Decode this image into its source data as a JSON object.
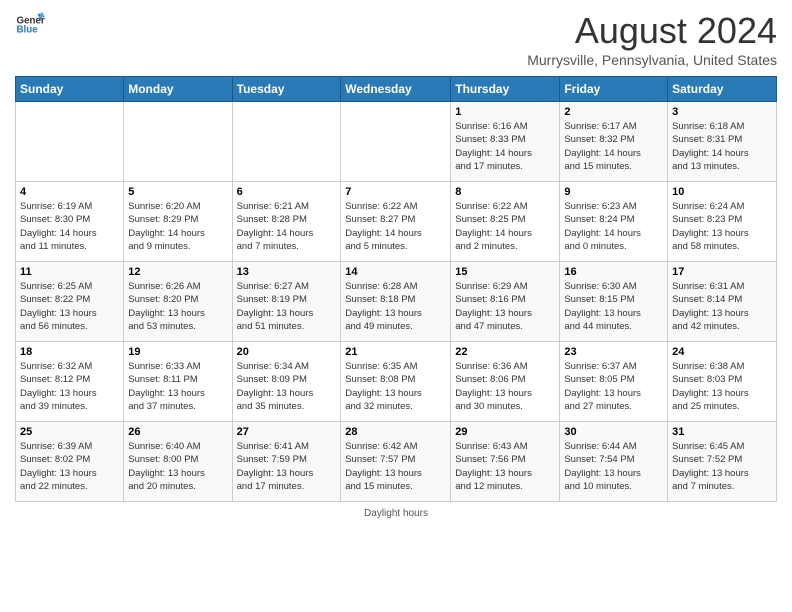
{
  "header": {
    "logo_line1": "General",
    "logo_line2": "Blue",
    "month_year": "August 2024",
    "location": "Murrysville, Pennsylvania, United States"
  },
  "days_of_week": [
    "Sunday",
    "Monday",
    "Tuesday",
    "Wednesday",
    "Thursday",
    "Friday",
    "Saturday"
  ],
  "weeks": [
    [
      {
        "day": "",
        "info": ""
      },
      {
        "day": "",
        "info": ""
      },
      {
        "day": "",
        "info": ""
      },
      {
        "day": "",
        "info": ""
      },
      {
        "day": "1",
        "info": "Sunrise: 6:16 AM\nSunset: 8:33 PM\nDaylight: 14 hours\nand 17 minutes."
      },
      {
        "day": "2",
        "info": "Sunrise: 6:17 AM\nSunset: 8:32 PM\nDaylight: 14 hours\nand 15 minutes."
      },
      {
        "day": "3",
        "info": "Sunrise: 6:18 AM\nSunset: 8:31 PM\nDaylight: 14 hours\nand 13 minutes."
      }
    ],
    [
      {
        "day": "4",
        "info": "Sunrise: 6:19 AM\nSunset: 8:30 PM\nDaylight: 14 hours\nand 11 minutes."
      },
      {
        "day": "5",
        "info": "Sunrise: 6:20 AM\nSunset: 8:29 PM\nDaylight: 14 hours\nand 9 minutes."
      },
      {
        "day": "6",
        "info": "Sunrise: 6:21 AM\nSunset: 8:28 PM\nDaylight: 14 hours\nand 7 minutes."
      },
      {
        "day": "7",
        "info": "Sunrise: 6:22 AM\nSunset: 8:27 PM\nDaylight: 14 hours\nand 5 minutes."
      },
      {
        "day": "8",
        "info": "Sunrise: 6:22 AM\nSunset: 8:25 PM\nDaylight: 14 hours\nand 2 minutes."
      },
      {
        "day": "9",
        "info": "Sunrise: 6:23 AM\nSunset: 8:24 PM\nDaylight: 14 hours\nand 0 minutes."
      },
      {
        "day": "10",
        "info": "Sunrise: 6:24 AM\nSunset: 8:23 PM\nDaylight: 13 hours\nand 58 minutes."
      }
    ],
    [
      {
        "day": "11",
        "info": "Sunrise: 6:25 AM\nSunset: 8:22 PM\nDaylight: 13 hours\nand 56 minutes."
      },
      {
        "day": "12",
        "info": "Sunrise: 6:26 AM\nSunset: 8:20 PM\nDaylight: 13 hours\nand 53 minutes."
      },
      {
        "day": "13",
        "info": "Sunrise: 6:27 AM\nSunset: 8:19 PM\nDaylight: 13 hours\nand 51 minutes."
      },
      {
        "day": "14",
        "info": "Sunrise: 6:28 AM\nSunset: 8:18 PM\nDaylight: 13 hours\nand 49 minutes."
      },
      {
        "day": "15",
        "info": "Sunrise: 6:29 AM\nSunset: 8:16 PM\nDaylight: 13 hours\nand 47 minutes."
      },
      {
        "day": "16",
        "info": "Sunrise: 6:30 AM\nSunset: 8:15 PM\nDaylight: 13 hours\nand 44 minutes."
      },
      {
        "day": "17",
        "info": "Sunrise: 6:31 AM\nSunset: 8:14 PM\nDaylight: 13 hours\nand 42 minutes."
      }
    ],
    [
      {
        "day": "18",
        "info": "Sunrise: 6:32 AM\nSunset: 8:12 PM\nDaylight: 13 hours\nand 39 minutes."
      },
      {
        "day": "19",
        "info": "Sunrise: 6:33 AM\nSunset: 8:11 PM\nDaylight: 13 hours\nand 37 minutes."
      },
      {
        "day": "20",
        "info": "Sunrise: 6:34 AM\nSunset: 8:09 PM\nDaylight: 13 hours\nand 35 minutes."
      },
      {
        "day": "21",
        "info": "Sunrise: 6:35 AM\nSunset: 8:08 PM\nDaylight: 13 hours\nand 32 minutes."
      },
      {
        "day": "22",
        "info": "Sunrise: 6:36 AM\nSunset: 8:06 PM\nDaylight: 13 hours\nand 30 minutes."
      },
      {
        "day": "23",
        "info": "Sunrise: 6:37 AM\nSunset: 8:05 PM\nDaylight: 13 hours\nand 27 minutes."
      },
      {
        "day": "24",
        "info": "Sunrise: 6:38 AM\nSunset: 8:03 PM\nDaylight: 13 hours\nand 25 minutes."
      }
    ],
    [
      {
        "day": "25",
        "info": "Sunrise: 6:39 AM\nSunset: 8:02 PM\nDaylight: 13 hours\nand 22 minutes."
      },
      {
        "day": "26",
        "info": "Sunrise: 6:40 AM\nSunset: 8:00 PM\nDaylight: 13 hours\nand 20 minutes."
      },
      {
        "day": "27",
        "info": "Sunrise: 6:41 AM\nSunset: 7:59 PM\nDaylight: 13 hours\nand 17 minutes."
      },
      {
        "day": "28",
        "info": "Sunrise: 6:42 AM\nSunset: 7:57 PM\nDaylight: 13 hours\nand 15 minutes."
      },
      {
        "day": "29",
        "info": "Sunrise: 6:43 AM\nSunset: 7:56 PM\nDaylight: 13 hours\nand 12 minutes."
      },
      {
        "day": "30",
        "info": "Sunrise: 6:44 AM\nSunset: 7:54 PM\nDaylight: 13 hours\nand 10 minutes."
      },
      {
        "day": "31",
        "info": "Sunrise: 6:45 AM\nSunset: 7:52 PM\nDaylight: 13 hours\nand 7 minutes."
      }
    ]
  ],
  "footer": {
    "daylight_label": "Daylight hours"
  }
}
